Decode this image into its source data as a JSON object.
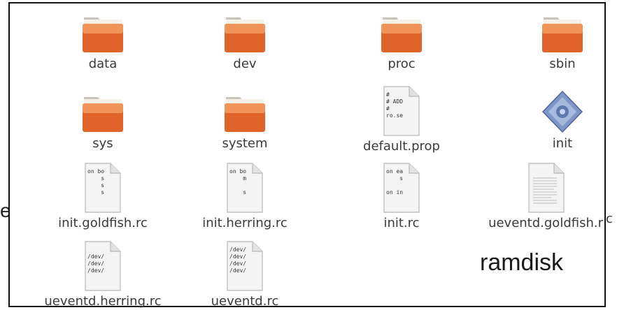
{
  "window": {
    "title": ""
  },
  "items": [
    {
      "label": "data",
      "icon": "folder-icon"
    },
    {
      "label": "dev",
      "icon": "folder-icon"
    },
    {
      "label": "proc",
      "icon": "folder-icon"
    },
    {
      "label": "sbin",
      "icon": "folder-icon"
    },
    {
      "label": "sys",
      "icon": "folder-icon"
    },
    {
      "label": "system",
      "icon": "folder-icon"
    },
    {
      "label": "default.prop",
      "icon": "text-file-icon",
      "preview": [
        "#",
        "# ADD",
        "#",
        "ro.se"
      ]
    },
    {
      "label": "init",
      "icon": "executable-icon"
    },
    {
      "label": "init.goldfish.rc",
      "icon": "text-file-icon",
      "preview": [
        "on bo",
        "    s",
        "    s",
        "    s"
      ]
    },
    {
      "label": "init.herring.rc",
      "icon": "text-file-icon",
      "preview": [
        "on bo",
        "    m",
        "",
        "    s"
      ]
    },
    {
      "label": "init.rc",
      "icon": "text-file-icon",
      "preview": [
        "on ea",
        "    s",
        "",
        "on in"
      ]
    },
    {
      "label": "ueventd.goldfish.r",
      "icon": "text-file-icon",
      "preview": []
    },
    {
      "label": "ueventd.herring.rc",
      "icon": "text-file-icon",
      "preview": [
        "/dev/",
        "/dev/",
        "/dev/"
      ]
    },
    {
      "label": "ueventd.rc",
      "icon": "text-file-icon",
      "preview": [
        "/dev/",
        "/dev/",
        "/dev/",
        "/dev/"
      ]
    }
  ],
  "overflow_text": {
    "left_edge": "e",
    "right_edge": "c"
  },
  "caption": "ramdisk",
  "colors": {
    "folder_top": "#f2935a",
    "folder_body": "#e0642a",
    "folder_tab": "#f5f0e8",
    "doc_bg": "#f4f4f4",
    "frame_border": "#111111"
  }
}
